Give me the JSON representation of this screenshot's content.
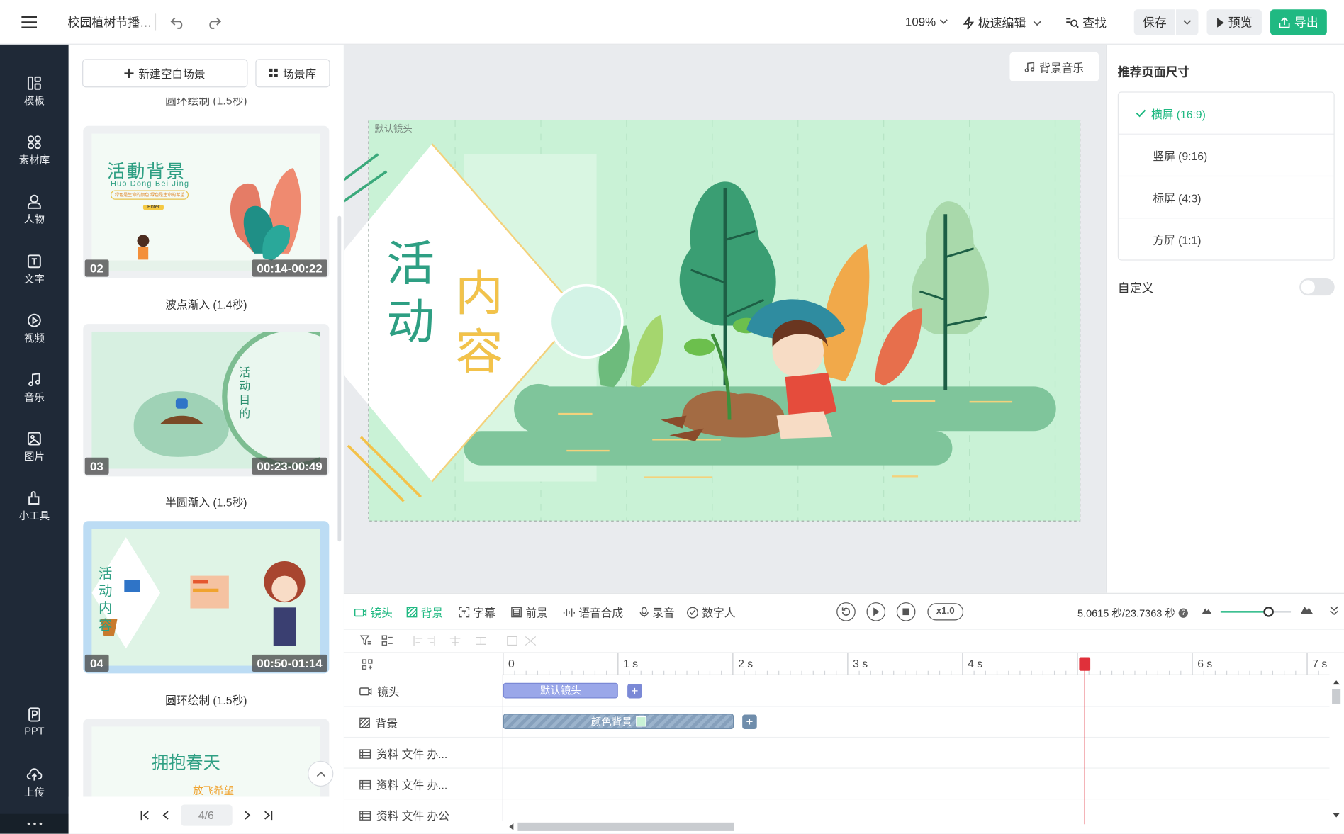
{
  "topbar": {
    "title": "校园植树节播…",
    "zoom": "109%",
    "mode": "极速编辑",
    "find": "查找",
    "save": "保存",
    "preview": "预览",
    "export": "导出"
  },
  "sidebar": {
    "items": [
      {
        "label": "模板",
        "icon": "template-icon"
      },
      {
        "label": "素材库",
        "icon": "material-library-icon"
      },
      {
        "label": "人物",
        "icon": "person-icon"
      },
      {
        "label": "文字",
        "icon": "text-icon"
      },
      {
        "label": "视频",
        "icon": "video-icon"
      },
      {
        "label": "音乐",
        "icon": "music-icon"
      },
      {
        "label": "图片",
        "icon": "image-icon"
      },
      {
        "label": "小工具",
        "icon": "tools-icon"
      }
    ],
    "bottom": [
      {
        "label": "PPT",
        "icon": "ppt-icon"
      },
      {
        "label": "上传",
        "icon": "upload-icon"
      }
    ]
  },
  "scenes": {
    "new_blank": "新建空白场景",
    "library": "场景库",
    "top_caption": "圆环绘制 (1.5秒)",
    "items": [
      {
        "num": "02",
        "time": "00:14-00:22",
        "caption": "波点渐入 (1.4秒)",
        "t_title": "活動背景",
        "t_sub": "Huo Dong Bei Jing",
        "t_btn": "Enter",
        "t_line": "绿色是生命的颜色 绿色是生命的希望"
      },
      {
        "num": "03",
        "time": "00:23-00:49",
        "caption": "半圆渐入 (1.5秒)",
        "t_title": "活动目的"
      },
      {
        "num": "04",
        "time": "00:50-01:14",
        "caption": "圆环绘制 (1.5秒)",
        "t_title": "活动内容"
      },
      {
        "t_title": "拥抱春天",
        "t_sub": "放飞希望"
      }
    ],
    "pager": "4/6"
  },
  "canvas": {
    "bg_music": "背景音乐",
    "lens_label": "默认镜头",
    "title_a": "活动",
    "title_b": "内容"
  },
  "right": {
    "heading": "推荐页面尺寸",
    "options": [
      "横屏 (16:9)",
      "竖屏 (9:16)",
      "标屏 (4:3)",
      "方屏 (1:1)"
    ],
    "selected": 0,
    "custom": "自定义",
    "custom_on": false
  },
  "timeline": {
    "tabs": [
      "镜头",
      "背景",
      "字幕",
      "前景",
      "语音合成",
      "录音",
      "数字人"
    ],
    "active_tabs": [
      0,
      1
    ],
    "speed": "x1.0",
    "time": "5.0615 秒/23.7363 秒",
    "ruler": [
      "0",
      "1 s",
      "2 s",
      "3 s",
      "4 s",
      "s",
      "6 s",
      "7 s"
    ],
    "tracks": [
      {
        "label": "镜头",
        "clip": "默认镜头"
      },
      {
        "label": "背景",
        "clip": "颜色背景"
      },
      {
        "label": "资料 文件 办..."
      },
      {
        "label": "资料 文件 办..."
      },
      {
        "label": "资料 文件 办公"
      }
    ],
    "playhead_seconds": 5.06
  }
}
